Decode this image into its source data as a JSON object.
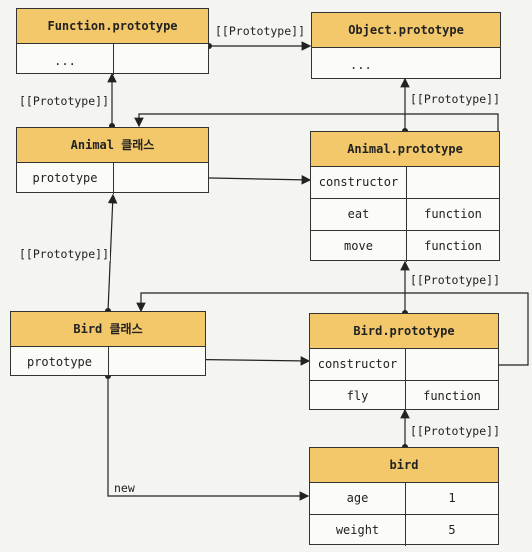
{
  "function_prototype": {
    "title": "Function.prototype",
    "rows": [
      [
        "...",
        ""
      ]
    ]
  },
  "object_prototype": {
    "title": "Object.prototype",
    "rows": [
      [
        "..."
      ]
    ]
  },
  "animal_class": {
    "title": "Animal 클래스",
    "rows": [
      [
        "prototype",
        ""
      ]
    ]
  },
  "animal_prototype": {
    "title": "Animal.prototype",
    "rows": [
      [
        "constructor",
        ""
      ],
      [
        "eat",
        "function"
      ],
      [
        "move",
        "function"
      ]
    ]
  },
  "bird_class": {
    "title": "Bird 클래스",
    "rows": [
      [
        "prototype",
        ""
      ]
    ]
  },
  "bird_prototype": {
    "title": "Bird.prototype",
    "rows": [
      [
        "constructor",
        ""
      ],
      [
        "fly",
        "function"
      ]
    ]
  },
  "bird": {
    "title": "bird",
    "rows": [
      [
        "age",
        "1"
      ],
      [
        "weight",
        "5"
      ]
    ]
  },
  "labels": {
    "proto_func_to_obj": "[[Prototype]]",
    "proto_animal_to_func": "[[Prototype]]",
    "proto_animalproto_to_obj": "[[Prototype]]",
    "proto_bird_to_animal": "[[Prototype]]",
    "proto_birdproto_to_animalproto": "[[Prototype]]",
    "proto_birdobj_to_birdproto": "[[Prototype]]",
    "new": "new"
  }
}
